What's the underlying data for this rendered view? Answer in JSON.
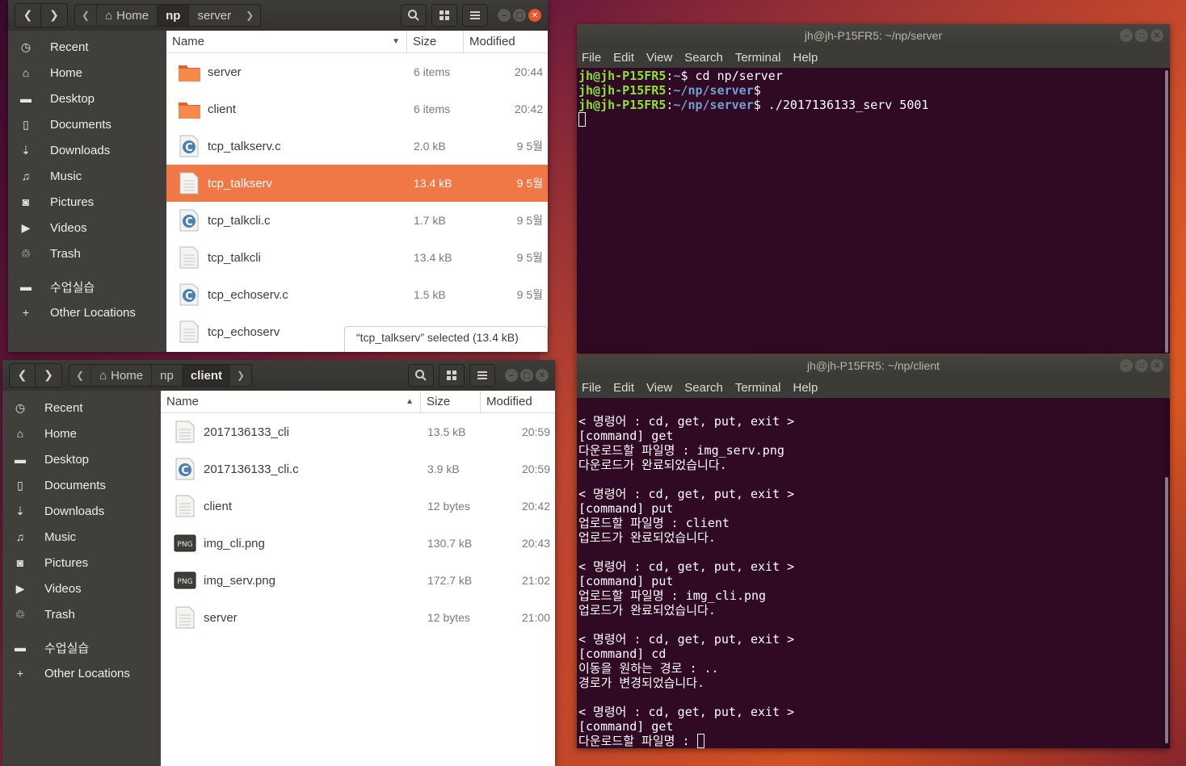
{
  "top_fm": {
    "path": [
      {
        "label": "Home",
        "home": true
      },
      {
        "label": "np",
        "active": true
      },
      {
        "label": "server"
      }
    ],
    "columns": {
      "name": "Name",
      "size": "Size",
      "modified": "Modified"
    },
    "sidebar": [
      {
        "label": "Recent",
        "icon": "clock-icon",
        "glyph": "◷"
      },
      {
        "label": "Home",
        "icon": "home-icon",
        "glyph": "⌂"
      },
      {
        "label": "Desktop",
        "icon": "folder-icon",
        "glyph": "▬"
      },
      {
        "label": "Documents",
        "icon": "document-icon",
        "glyph": "▯"
      },
      {
        "label": "Downloads",
        "icon": "download-icon",
        "glyph": "⇣"
      },
      {
        "label": "Music",
        "icon": "music-icon",
        "glyph": "♫"
      },
      {
        "label": "Pictures",
        "icon": "camera-icon",
        "glyph": "◙"
      },
      {
        "label": "Videos",
        "icon": "video-icon",
        "glyph": "▶"
      },
      {
        "label": "Trash",
        "icon": "trash-icon",
        "glyph": "♲"
      },
      {
        "label": "수업실습",
        "icon": "folder-icon",
        "glyph": "▬",
        "sep": true
      },
      {
        "label": "Other Locations",
        "icon": "plus-icon",
        "glyph": "+"
      }
    ],
    "files": [
      {
        "name": "server",
        "size": "6 items",
        "modified": "20:44",
        "type": "folder"
      },
      {
        "name": "client",
        "size": "6 items",
        "modified": "20:42",
        "type": "folder"
      },
      {
        "name": "tcp_talkserv.c",
        "size": "2.0 kB",
        "modified": "9 5월",
        "type": "c"
      },
      {
        "name": "tcp_talkserv",
        "size": "13.4 kB",
        "modified": "9 5월",
        "type": "binary",
        "selected": true
      },
      {
        "name": "tcp_talkcli.c",
        "size": "1.7 kB",
        "modified": "9 5월",
        "type": "c"
      },
      {
        "name": "tcp_talkcli",
        "size": "13.4 kB",
        "modified": "9 5월",
        "type": "binary"
      },
      {
        "name": "tcp_echoserv.c",
        "size": "1.5 kB",
        "modified": "9 5월",
        "type": "c"
      },
      {
        "name": "tcp_echoserv",
        "size": "",
        "modified": "",
        "type": "binary"
      }
    ],
    "status": "“tcp_talkserv” selected  (13.4 kB)"
  },
  "bottom_fm": {
    "path": [
      {
        "label": "Home",
        "home": true
      },
      {
        "label": "np"
      },
      {
        "label": "client",
        "active": true
      }
    ],
    "columns": {
      "name": "Name",
      "size": "Size",
      "modified": "Modified"
    },
    "sidebar": [
      {
        "label": "Recent",
        "icon": "clock-icon",
        "glyph": "◷"
      },
      {
        "label": "Home",
        "icon": "home-icon",
        "glyph": "⌂"
      },
      {
        "label": "Desktop",
        "icon": "folder-icon",
        "glyph": "▬"
      },
      {
        "label": "Documents",
        "icon": "document-icon",
        "glyph": "▯"
      },
      {
        "label": "Downloads",
        "icon": "download-icon",
        "glyph": "⇣"
      },
      {
        "label": "Music",
        "icon": "music-icon",
        "glyph": "♫"
      },
      {
        "label": "Pictures",
        "icon": "camera-icon",
        "glyph": "◙"
      },
      {
        "label": "Videos",
        "icon": "video-icon",
        "glyph": "▶"
      },
      {
        "label": "Trash",
        "icon": "trash-icon",
        "glyph": "♲"
      },
      {
        "label": "수업실습",
        "icon": "folder-icon",
        "glyph": "▬",
        "sep": true
      },
      {
        "label": "Other Locations",
        "icon": "plus-icon",
        "glyph": "+"
      }
    ],
    "files": [
      {
        "name": "2017136133_cli",
        "size": "13.5 kB",
        "modified": "20:59",
        "type": "binary"
      },
      {
        "name": "2017136133_cli.c",
        "size": "3.9 kB",
        "modified": "20:59",
        "type": "c"
      },
      {
        "name": "client",
        "size": "12 bytes",
        "modified": "20:42",
        "type": "binary"
      },
      {
        "name": "img_cli.png",
        "size": "130.7 kB",
        "modified": "20:43",
        "type": "png"
      },
      {
        "name": "img_serv.png",
        "size": "172.7 kB",
        "modified": "21:02",
        "type": "png"
      },
      {
        "name": "server",
        "size": "12 bytes",
        "modified": "21:00",
        "type": "binary"
      }
    ]
  },
  "term_server": {
    "title": "jh@jh-P15FR5: ~/np/server",
    "menu": [
      "File",
      "Edit",
      "View",
      "Search",
      "Terminal",
      "Help"
    ],
    "lines": [
      [
        {
          "t": "jh@jh-P15FR5",
          "c": "user"
        },
        {
          "t": ":"
        },
        {
          "t": "~",
          "c": "path"
        },
        {
          "t": "$ cd np/server"
        }
      ],
      [
        {
          "t": "jh@jh-P15FR5",
          "c": "user"
        },
        {
          "t": ":"
        },
        {
          "t": "~/np/server",
          "c": "path"
        },
        {
          "t": "$"
        }
      ],
      [
        {
          "t": "jh@jh-P15FR5",
          "c": "user"
        },
        {
          "t": ":"
        },
        {
          "t": "~/np/server",
          "c": "path"
        },
        {
          "t": "$ ./2017136133_serv 5001"
        }
      ],
      [
        {
          "t": "",
          "cursor": true
        }
      ]
    ]
  },
  "term_client": {
    "title": "jh@jh-P15FR5: ~/np/client",
    "menu": [
      "File",
      "Edit",
      "View",
      "Search",
      "Terminal",
      "Help"
    ],
    "lines": [
      [
        {
          "t": ""
        }
      ],
      [
        {
          "t": "< 명령어 : cd, get, put, exit >"
        }
      ],
      [
        {
          "t": "[command] get"
        }
      ],
      [
        {
          "t": "다운로드할 파일명 : img_serv.png"
        }
      ],
      [
        {
          "t": "다운로드가 완료되었습니다."
        }
      ],
      [
        {
          "t": ""
        }
      ],
      [
        {
          "t": "< 명령어 : cd, get, put, exit >"
        }
      ],
      [
        {
          "t": "[command] put"
        }
      ],
      [
        {
          "t": "업로드할 파일명 : client"
        }
      ],
      [
        {
          "t": "업로드가 완료되었습니다."
        }
      ],
      [
        {
          "t": ""
        }
      ],
      [
        {
          "t": "< 명령어 : cd, get, put, exit >"
        }
      ],
      [
        {
          "t": "[command] put"
        }
      ],
      [
        {
          "t": "업로드할 파일명 : img_cli.png"
        }
      ],
      [
        {
          "t": "업로드가 완료되었습니다."
        }
      ],
      [
        {
          "t": ""
        }
      ],
      [
        {
          "t": "< 명령어 : cd, get, put, exit >"
        }
      ],
      [
        {
          "t": "[command] cd"
        }
      ],
      [
        {
          "t": "이동을 원하는 경로 : .."
        }
      ],
      [
        {
          "t": "경로가 변경되었습니다."
        }
      ],
      [
        {
          "t": ""
        }
      ],
      [
        {
          "t": "< 명령어 : cd, get, put, exit >"
        }
      ],
      [
        {
          "t": "[command] get"
        }
      ],
      [
        {
          "t": "다운로드할 파일명 : "
        },
        {
          "t": "",
          "cursor": true
        }
      ]
    ]
  },
  "colors": {
    "selection": "#f07746",
    "folder": "#e65f2a",
    "terminal_bg": "#300a24",
    "prompt_user": "#8ae234",
    "prompt_path": "#729fcf"
  }
}
